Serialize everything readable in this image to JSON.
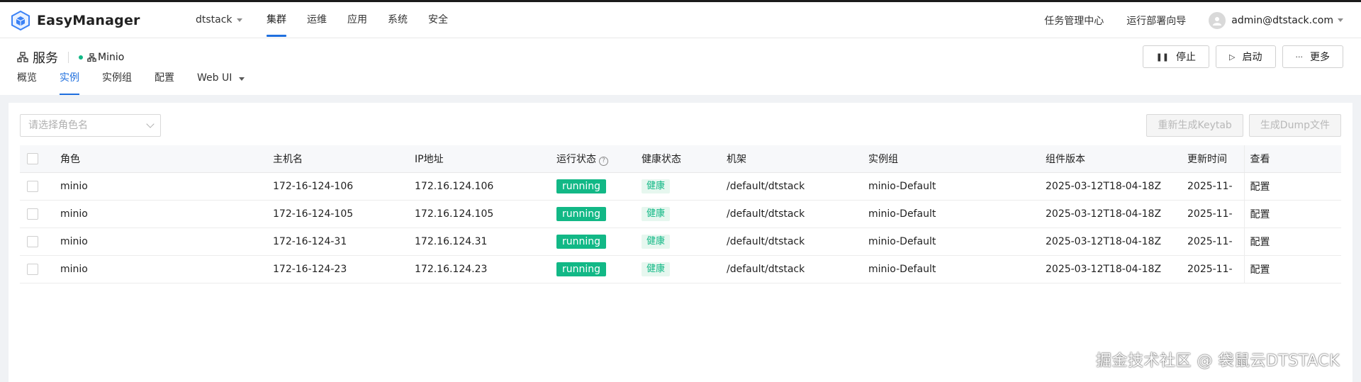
{
  "app": {
    "name": "EasyManager",
    "cluster": "dtstack"
  },
  "colors": {
    "accent": "#1f6fde",
    "running": "#12b886",
    "healthy_bg": "#e6f7ef"
  },
  "nav": [
    {
      "label": "集群",
      "active": true
    },
    {
      "label": "运维",
      "active": false
    },
    {
      "label": "应用",
      "active": false
    },
    {
      "label": "系统",
      "active": false
    },
    {
      "label": "安全",
      "active": false
    }
  ],
  "header_right": {
    "task_center": "任务管理中心",
    "deploy_wizard": "运行部署向导",
    "user": "admin@dtstack.com"
  },
  "page": {
    "title": "服务",
    "service": "Minio",
    "actions": {
      "stop": "停止",
      "start": "启动",
      "more": "更多"
    },
    "tabs": [
      {
        "label": "概览",
        "active": false
      },
      {
        "label": "实例",
        "active": true
      },
      {
        "label": "实例组",
        "active": false
      },
      {
        "label": "配置",
        "active": false
      },
      {
        "label": "Web UI",
        "active": false
      }
    ]
  },
  "toolbar": {
    "role_placeholder": "请选择角色名",
    "regen_keytab": "重新生成Keytab",
    "gen_dump": "生成Dump文件"
  },
  "table": {
    "columns": [
      "角色",
      "主机名",
      "IP地址",
      "运行状态",
      "健康状态",
      "机架",
      "实例组",
      "组件版本",
      "更新时间",
      "查看"
    ],
    "rows": [
      {
        "role": "minio",
        "host": "172-16-124-106",
        "ip": "172.16.124.106",
        "run": "running",
        "health": "健康",
        "rack": "/default/dtstack",
        "group": "minio-Default",
        "version": "2025-03-12T18-04-18Z",
        "updated": "2025-11-",
        "view": "配置"
      },
      {
        "role": "minio",
        "host": "172-16-124-105",
        "ip": "172.16.124.105",
        "run": "running",
        "health": "健康",
        "rack": "/default/dtstack",
        "group": "minio-Default",
        "version": "2025-03-12T18-04-18Z",
        "updated": "2025-11-",
        "view": "配置"
      },
      {
        "role": "minio",
        "host": "172-16-124-31",
        "ip": "172.16.124.31",
        "run": "running",
        "health": "健康",
        "rack": "/default/dtstack",
        "group": "minio-Default",
        "version": "2025-03-12T18-04-18Z",
        "updated": "2025-11-",
        "view": "配置"
      },
      {
        "role": "minio",
        "host": "172-16-124-23",
        "ip": "172.16.124.23",
        "run": "running",
        "health": "健康",
        "rack": "/default/dtstack",
        "group": "minio-Default",
        "version": "2025-03-12T18-04-18Z",
        "updated": "2025-11-",
        "view": "配置"
      }
    ]
  },
  "watermark": "掘金技术社区 @ 袋鼠云DTSTACK"
}
